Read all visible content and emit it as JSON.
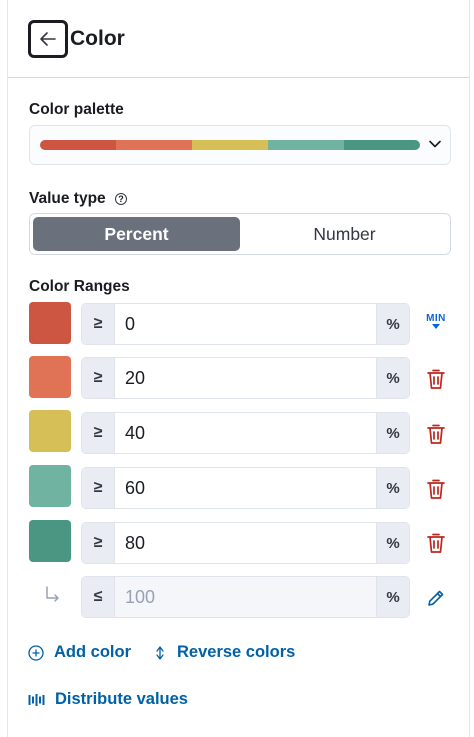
{
  "header": {
    "title": "Color"
  },
  "palette": {
    "label": "Color palette",
    "colors": [
      "#cc5642",
      "#e07256",
      "#d6bf57",
      "#6fb3a0",
      "#4a9683"
    ]
  },
  "value_type": {
    "label": "Value type",
    "options": [
      "Percent",
      "Number"
    ],
    "selected": "Percent"
  },
  "ranges": {
    "label": "Color Ranges",
    "rows": [
      {
        "color": "#cc5642",
        "op": "≥",
        "value": "0",
        "unit": "%",
        "action": "MIN"
      },
      {
        "color": "#e07256",
        "op": "≥",
        "value": "20",
        "unit": "%",
        "action": "delete"
      },
      {
        "color": "#d6bf57",
        "op": "≥",
        "value": "40",
        "unit": "%",
        "action": "delete"
      },
      {
        "color": "#6fb3a0",
        "op": "≥",
        "value": "60",
        "unit": "%",
        "action": "delete"
      },
      {
        "color": "#4a9683",
        "op": "≥",
        "value": "80",
        "unit": "%",
        "action": "delete"
      }
    ],
    "last": {
      "op": "≤",
      "value": "100",
      "unit": "%",
      "action": "edit"
    }
  },
  "actions": {
    "add_color": "Add color",
    "reverse_colors": "Reverse colors",
    "distribute_values": "Distribute values"
  },
  "colors": {
    "link": "#0061a6",
    "delete": "#bd271e",
    "min": "#0b64dd"
  }
}
